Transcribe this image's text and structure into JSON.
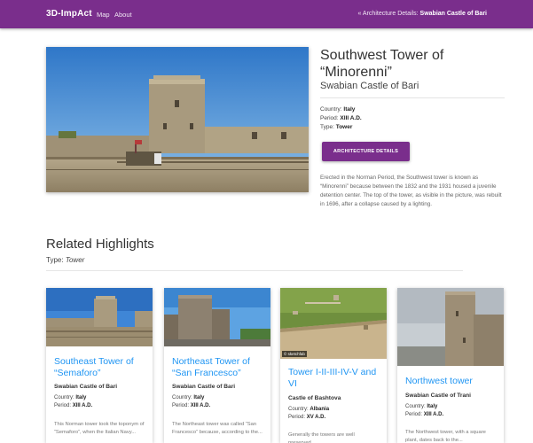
{
  "nav": {
    "brand": "3D-ImpAct",
    "links": [
      "Map",
      "About"
    ],
    "breadcrumb_prefix": "« Architecture Details:",
    "breadcrumb_current": "Swabian Castle of Bari"
  },
  "hero": {
    "title": "Southwest Tower of “Minorenni”",
    "subtitle": "Swabian Castle of Bari",
    "country_label": "Country:",
    "country": "Italy",
    "period_label": "Period:",
    "period": "XIII A.D.",
    "type_label": "Type:",
    "type": "Tower",
    "button_label": "Architecture Details",
    "description": "Erected in the Norman Period, the Southwest tower is known as “Minorenni” because between the 1832 and the 1931 housed a juvenile detention center. The top of the tower, as visible in the picture, was rebuilt in 1696, after a collapse caused by a lighting."
  },
  "related": {
    "heading": "Related Highlights",
    "type_label": "Type:",
    "type_value": "Tower",
    "cards": [
      {
        "title": "Southeast Tower of “Semaforo”",
        "castle": "Swabian Castle of Bari",
        "country_label": "Country:",
        "country": "Italy",
        "period_label": "Period:",
        "period": "XIII A.D.",
        "description": "This Norman tower took the toponym of “Semaforo”, when the Italian Navy..."
      },
      {
        "title": "Northeast Tower of “San Francesco”",
        "castle": "Swabian Castle of Bari",
        "country_label": "Country:",
        "country": "Italy",
        "period_label": "Period:",
        "period": "XIII A.D.",
        "description": "The Northeast tower was called “San Francesco” because, according to the..."
      },
      {
        "title": "Tower I-II-III-IV-V and VI",
        "castle": "Castle of Bashtova",
        "country_label": "Country:",
        "country": "Albania",
        "period_label": "Period:",
        "period": "XV A.D.",
        "description": "Generally the towers are well preserved...",
        "badge": "© sketchfab"
      },
      {
        "title": "Northwest tower",
        "castle": "Swabian Castle of Trani",
        "country_label": "Country:",
        "country": "Italy",
        "period_label": "Period:",
        "period": "XIII A.D.",
        "description": "The Northwest tower, with a square plant, dates back to the..."
      }
    ]
  },
  "colors": {
    "navbar": "#7a2e8c",
    "accent_button": "#7a2e8c",
    "card_title": "#2196f3"
  }
}
